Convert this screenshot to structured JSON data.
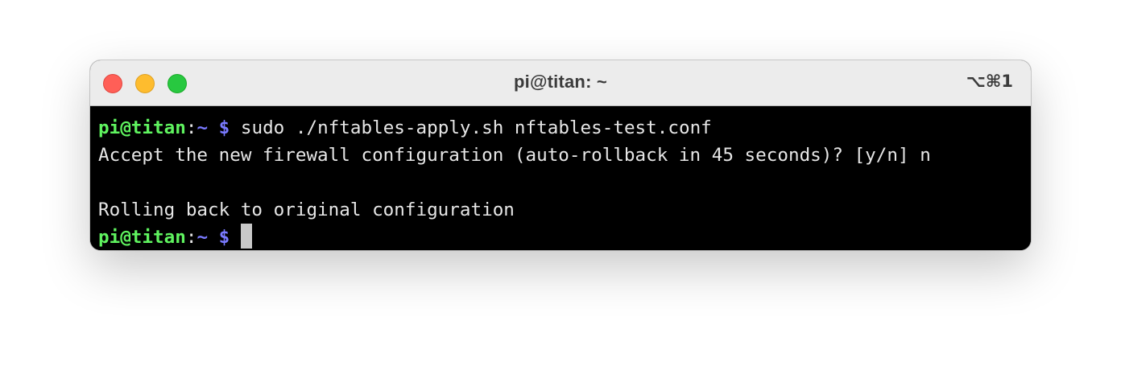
{
  "window": {
    "title": "pi@titan: ~",
    "shortcut": "⌥⌘1"
  },
  "terminal": {
    "prompt": {
      "user_host": "pi@titan",
      "separator": ":",
      "path": "~",
      "symbol": "$"
    },
    "lines": [
      {
        "type": "command",
        "text": " sudo ./nftables-apply.sh nftables-test.conf"
      },
      {
        "type": "output",
        "text": "Accept the new firewall configuration (auto-rollback in 45 seconds)? [y/n] n"
      },
      {
        "type": "output",
        "text": ""
      },
      {
        "type": "output",
        "text": "Rolling back to original configuration"
      },
      {
        "type": "command",
        "text": " "
      }
    ]
  },
  "colors": {
    "prompt_user": "#5ff35f",
    "prompt_path": "#7a7aff",
    "terminal_bg": "#000000",
    "terminal_fg": "#e6e6e6"
  }
}
